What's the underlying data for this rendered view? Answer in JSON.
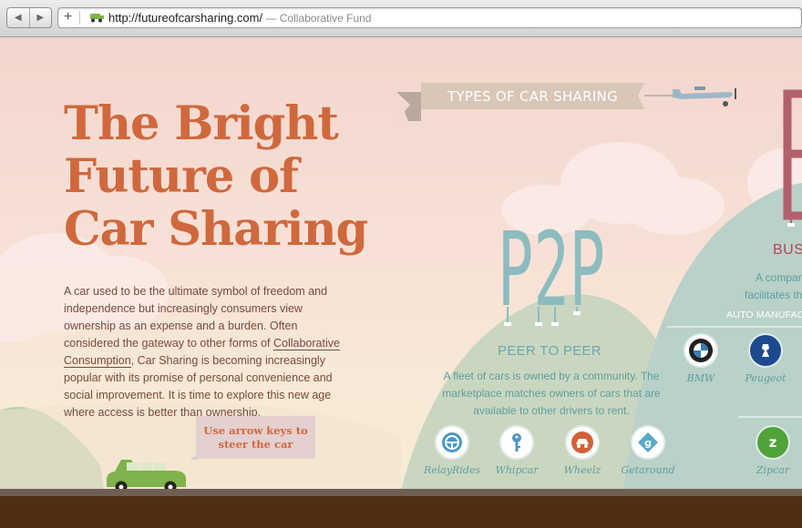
{
  "browser": {
    "url": "http://futureofcarsharing.com/",
    "title_suffix": " — Collaborative Fund",
    "back_icon": "back-arrow-icon",
    "forward_icon": "forward-arrow-icon"
  },
  "hero": {
    "title_lines": [
      "The Bright",
      "Future of",
      "Car Sharing"
    ],
    "intro_before": "A car used to be the ultimate symbol of freedom and independence but increasingly consumers view ownership as an expense and a burden. Often considered the gateway to other forms of ",
    "intro_link": "Collaborative Consumption",
    "intro_after": ", Car Sharing is becoming increasingly popular with its promise of personal convenience and social improvement. It is time to explore this new age where access is better than ownership.",
    "hint": "Use arrow keys to steer the car"
  },
  "types": {
    "ribbon": "TYPES OF CAR SHARING",
    "p2p": {
      "big": "P2P",
      "subtitle": "PEER TO PEER",
      "description": "A fleet of cars is owned by a community. The marketplace matches owners of cars that are available to other drivers to rent.",
      "services": [
        {
          "label": "RelayRides",
          "icon": "steering-wheel-icon"
        },
        {
          "label": "Whipcar",
          "icon": "key-icon"
        },
        {
          "label": "Wheelz",
          "icon": "car-wheel-icon"
        },
        {
          "label": "Getaround",
          "icon": "getaround-icon"
        }
      ]
    },
    "business": {
      "big": "B",
      "title": "BUSIN",
      "desc_lines": [
        "A compan",
        "facilitates the"
      ],
      "auto_label": "AUTO MANUFACTURERS",
      "brands": [
        {
          "label": "BMW",
          "icon": "bmw-logo-icon"
        },
        {
          "label": "Peugeot",
          "icon": "peugeot-logo-icon"
        },
        {
          "label": "Zipcar",
          "icon": "zipcar-logo-icon"
        }
      ]
    }
  },
  "colors": {
    "title": "#d0683d",
    "teal": "#6aa9ab",
    "car": "#7fb24a",
    "ground": "#4f2e13"
  }
}
